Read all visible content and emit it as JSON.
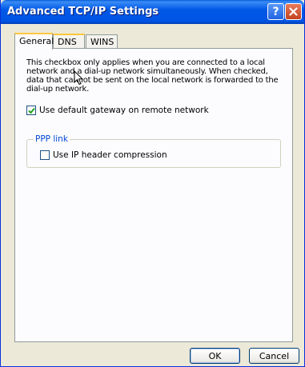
{
  "window": {
    "title": "Advanced TCP/IP Settings",
    "help_glyph": "?",
    "close_icon": "close-icon"
  },
  "tabs": [
    {
      "label": "General",
      "active": true
    },
    {
      "label": "DNS",
      "active": false,
      "hover": true
    },
    {
      "label": "WINS",
      "active": false
    }
  ],
  "general": {
    "description": "This checkbox only applies when you are connected to a local network and a dial-up network simultaneously.  When checked, data that cannot be sent on the local network is forwarded to the dial-up network.",
    "default_gateway_label": "Use default gateway on remote network",
    "default_gateway_checked": true,
    "ppp_group_label": "PPP link",
    "ip_header_label": "Use IP header compression",
    "ip_header_checked": false
  },
  "buttons": {
    "ok": "OK",
    "cancel": "Cancel"
  },
  "colors": {
    "titlebar": "#0054e3",
    "dialog_bg": "#ece9d8",
    "group_label": "#0046d5",
    "tab_hover": "#ffc83c"
  }
}
